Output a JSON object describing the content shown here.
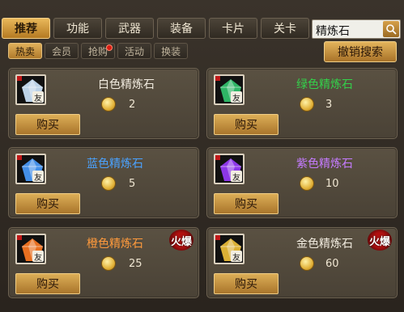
{
  "top_tabs": [
    {
      "label": "推荐",
      "active": true
    },
    {
      "label": "功能",
      "active": false
    },
    {
      "label": "武器",
      "active": false
    },
    {
      "label": "装备",
      "active": false
    },
    {
      "label": "卡片",
      "active": false
    },
    {
      "label": "关卡",
      "active": false
    }
  ],
  "search": {
    "value": "精炼石",
    "icon": "search-icon"
  },
  "sub_tabs": [
    {
      "label": "热卖",
      "active": true
    },
    {
      "label": "会员",
      "active": false
    },
    {
      "label": "抢购",
      "active": false,
      "dot": true
    },
    {
      "label": "活动",
      "active": false
    },
    {
      "label": "换装",
      "active": false
    }
  ],
  "cancel_search_label": "撤销搜索",
  "bind_label": "友",
  "buy_label": "购买",
  "hot_label": "火爆",
  "items": [
    {
      "name": "白色精炼石",
      "price": "2",
      "name_color": "#f2ece0",
      "gem_color": "#cfe8ff",
      "hot": false
    },
    {
      "name": "绿色精炼石",
      "price": "3",
      "name_color": "#33d14a",
      "gem_color": "#33c870",
      "hot": false
    },
    {
      "name": "蓝色精炼石",
      "price": "5",
      "name_color": "#4aa2ff",
      "gem_color": "#4a9dff",
      "hot": false
    },
    {
      "name": "紫色精炼石",
      "price": "10",
      "name_color": "#c57bff",
      "gem_color": "#9a3cff",
      "hot": false
    },
    {
      "name": "橙色精炼石",
      "price": "25",
      "name_color": "#ff9a3c",
      "gem_color": "#ff7a22",
      "hot": true
    },
    {
      "name": "金色精炼石",
      "price": "60",
      "name_color": "#f2ece0",
      "gem_color": "#f2c23a",
      "hot": true
    }
  ]
}
